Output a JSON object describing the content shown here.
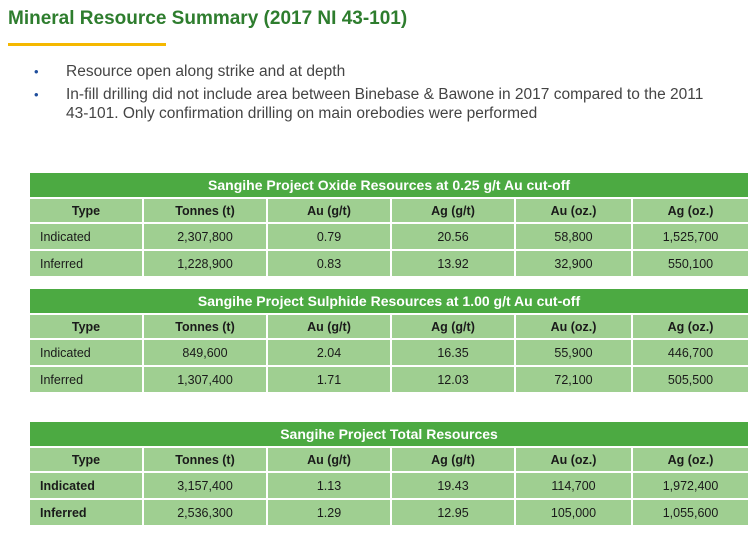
{
  "title": "Mineral Resource Summary (2017 NI 43-101)",
  "bullets": [
    "Resource open along strike and at depth",
    "In-fill drilling did not include area between Binebase & Bawone in 2017 compared to the 2011 43-101. Only confirmation drilling on main orebodies were performed"
  ],
  "columns": [
    "Type",
    "Tonnes (t)",
    "Au (g/t)",
    "Ag (g/t)",
    "Au (oz.)",
    "Ag (oz.)"
  ],
  "tables": [
    {
      "title": "Sangihe Project Oxide Resources  at 0.25 g/t Au cut-off",
      "rows": [
        {
          "type": "Indicated",
          "tonnes": "2,307,800",
          "au_gt": "0.79",
          "ag_gt": "20.56",
          "au_oz": "58,800",
          "ag_oz": "1,525,700"
        },
        {
          "type": "Inferred",
          "tonnes": "1,228,900",
          "au_gt": "0.83",
          "ag_gt": "13.92",
          "au_oz": "32,900",
          "ag_oz": "550,100"
        }
      ]
    },
    {
      "title": "Sangihe Project Sulphide Resources  at 1.00 g/t Au cut-off",
      "rows": [
        {
          "type": "Indicated",
          "tonnes": "849,600",
          "au_gt": "2.04",
          "ag_gt": "16.35",
          "au_oz": "55,900",
          "ag_oz": "446,700"
        },
        {
          "type": "Inferred",
          "tonnes": "1,307,400",
          "au_gt": "1.71",
          "ag_gt": "12.03",
          "au_oz": "72,100",
          "ag_oz": "505,500"
        }
      ]
    },
    {
      "title": "Sangihe Project Total Resources",
      "rows": [
        {
          "type": "Indicated",
          "tonnes": "3,157,400",
          "au_gt": "1.13",
          "ag_gt": "19.43",
          "au_oz": "114,700",
          "ag_oz": "1,972,400"
        },
        {
          "type": "Inferred",
          "tonnes": "2,536,300",
          "au_gt": "1.29",
          "ag_gt": "12.95",
          "au_oz": "105,000",
          "ag_oz": "1,055,600"
        }
      ]
    }
  ],
  "colors": {
    "title_green": "#2e7d2e",
    "accent_yellow": "#f5b800",
    "table_header_green": "#4caa42",
    "table_cell_green": "#9fcf91",
    "bullet_blue": "#1f4e9c"
  }
}
